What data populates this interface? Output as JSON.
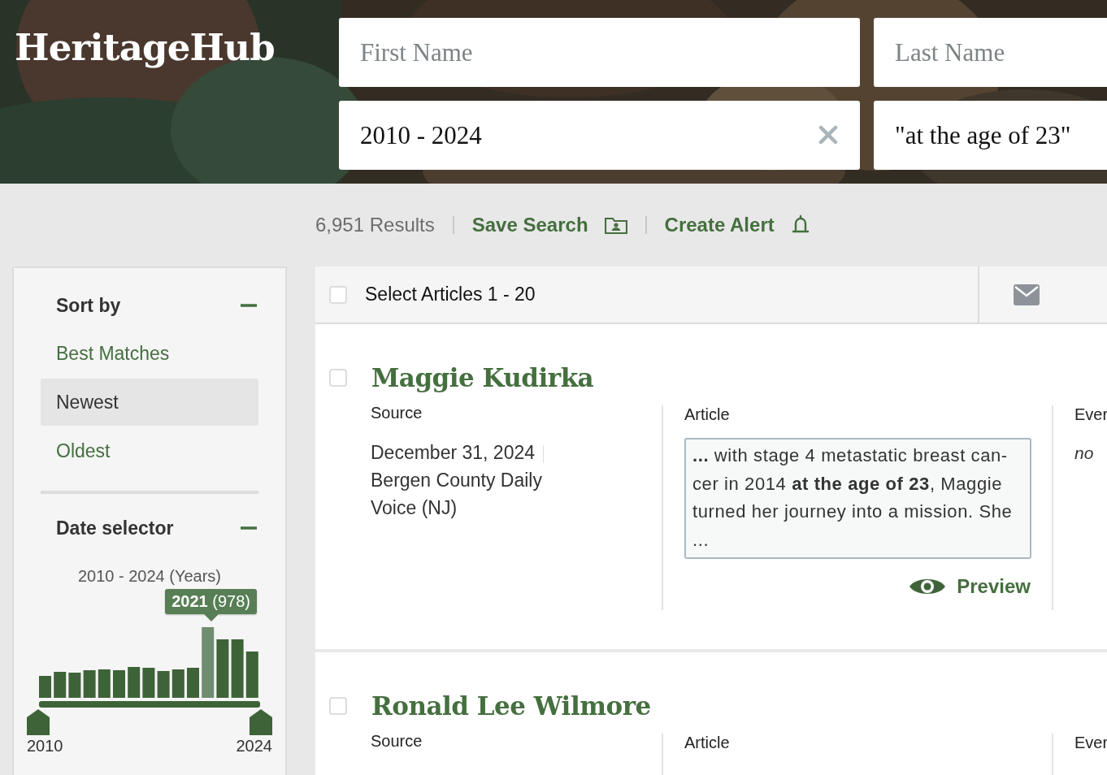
{
  "logo": "HeritageHub",
  "search_fields": [
    {
      "placeholder": "First Name"
    },
    {
      "placeholder": "Last Name"
    },
    {
      "value": "2010 - 2024",
      "clearable": true
    },
    {
      "value": "\"at the age of 23\"",
      "clearable": false
    }
  ],
  "results_bar": {
    "count": "6,951 Results",
    "save_search": "Save Search",
    "create_alert": "Create Alert"
  },
  "sidebar": {
    "sort": {
      "title": "Sort by",
      "expanded": true,
      "options": [
        {
          "label": "Best Matches",
          "selected": false
        },
        {
          "label": "Newest",
          "selected": true
        },
        {
          "label": "Oldest",
          "selected": false
        }
      ]
    },
    "date": {
      "title": "Date selector",
      "expanded": true,
      "range_label": "2010 - 2024 (Years)",
      "tooltip": "**2021** (978)",
      "start_label": "2010",
      "end_label": "2024"
    }
  },
  "list": {
    "select_all": {
      "label": "Select Articles 1 - 20",
      "checked": false
    },
    "results": [
      {
        "name": "Maggie Kudirka",
        "checked": false,
        "source_label": "Source",
        "date": "December 31, 2024",
        "publication": "Bergen County Daily Voice (NJ)",
        "article_label": "Article",
        "snippet": "**...** with stage 4 metastatic breast can-cer in 2014 **at the age of 23**, Maggie turned her journey into a mission. She ...",
        "preview": "Preview",
        "column_3_label": "Ever",
        "column_3_value": "no"
      },
      {
        "name": "Ronald Lee Wilmore",
        "checked": false,
        "source_label": "Source",
        "article_label": "Article",
        "column_3_label": "Ever"
      }
    ]
  }
}
